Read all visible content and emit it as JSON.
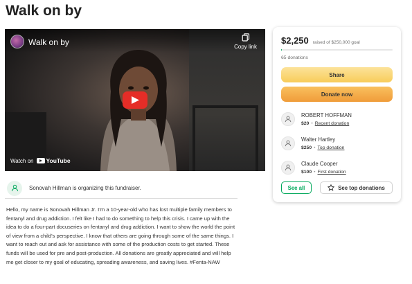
{
  "page": {
    "title": "Walk on by"
  },
  "video": {
    "title": "Walk on by",
    "copy_link_label": "Copy link",
    "watch_on_label": "Watch on",
    "youtube_label": "YouTube"
  },
  "organizer": {
    "text": "Sonovah Hillman is organizing this fundraiser."
  },
  "story": {
    "text": "Hello, my name is Sonovah Hillman Jr. I’m a 10-year-old who has lost multiple family members to fentanyl and drug addiction. I felt like I had to do something to help this crisis. I came up with the idea to do a four-part docuseries on fentanyl and drug addiction. I want to show the world the point of view from a child’s perspective. I know that others are going through some of the same things. I want to reach out and ask for assistance with some of the production costs to get started. These funds will be used for pre and post-production. All donations are greatly appreciated and will help me get closer to my goal of educating, spreading awareness, and saving lives. #Fenta-NAW"
  },
  "donation_card": {
    "amount_raised": "$2,250",
    "goal_text": "raised of $250,000 goal",
    "progress_fraction": 0.009,
    "donation_count": "65 donations",
    "share_label": "Share",
    "donate_label": "Donate now",
    "donors": [
      {
        "name": "ROBERT HOFFMAN",
        "amount": "$20",
        "tag": "Recent donation"
      },
      {
        "name": "Walter Hartley",
        "amount": "$250",
        "tag": "Top donation"
      },
      {
        "name": "Claude Cooper",
        "amount": "$100",
        "tag": "First donation"
      }
    ],
    "see_all_label": "See all",
    "see_top_label": "See top donations"
  },
  "colors": {
    "accent_green": "#02a95c",
    "share_yellow": "#fbd973",
    "donate_orange": "#f5a94a",
    "youtube_red": "#e52d27"
  },
  "icons": [
    "copy-icon",
    "play-icon",
    "youtube-logo-icon",
    "user-icon",
    "star-icon"
  ]
}
